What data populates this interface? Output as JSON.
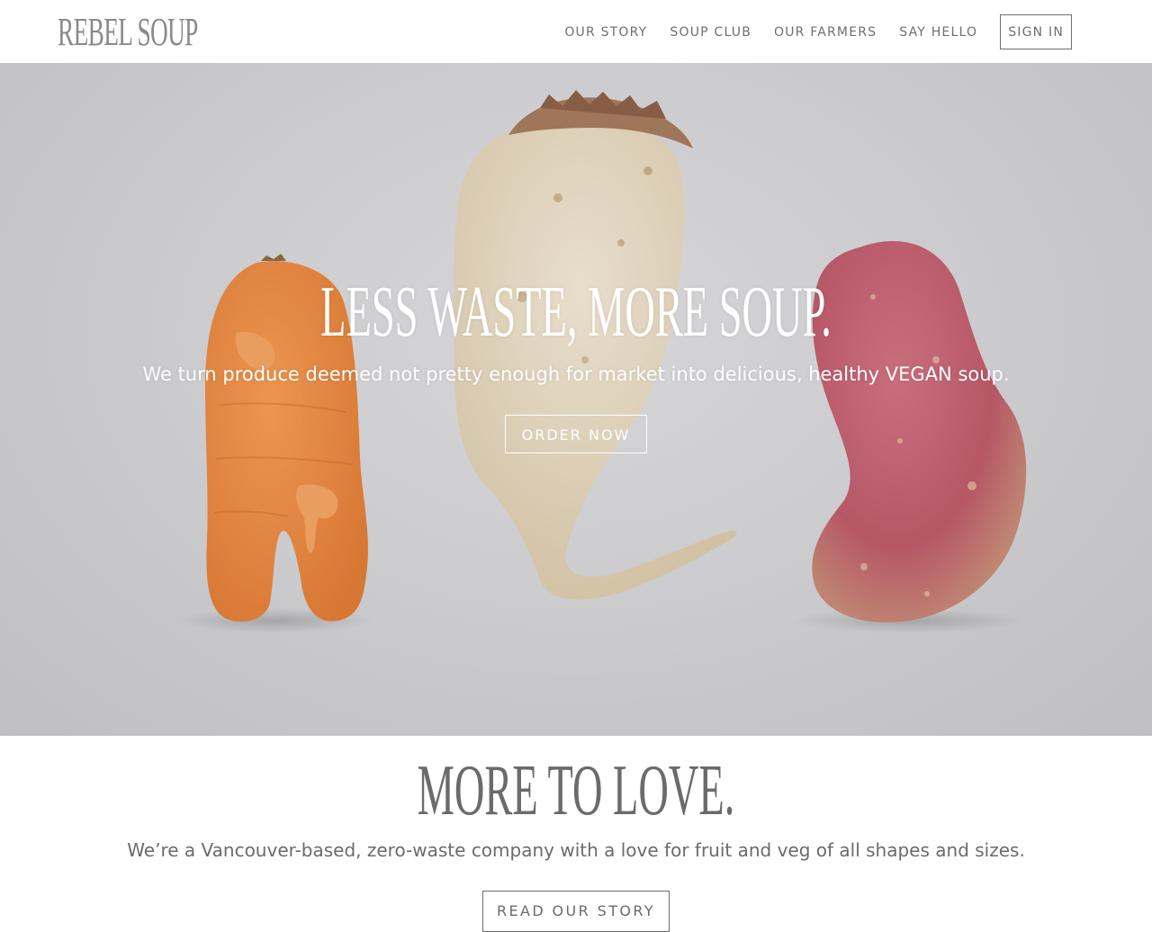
{
  "brand": {
    "logo_text": "REBEL SOUP"
  },
  "nav": {
    "items": [
      {
        "label": "OUR STORY"
      },
      {
        "label": "SOUP CLUB"
      },
      {
        "label": "OUR FARMERS"
      },
      {
        "label": "SAY HELLO"
      }
    ],
    "signin_label": "SIGN IN"
  },
  "hero": {
    "title": "LESS WASTE, MORE SOUP.",
    "subtitle": "We turn produce deemed not pretty enough for market into delicious, healthy VEGAN soup.",
    "cta_label": "ORDER NOW"
  },
  "about": {
    "title": "MORE TO LOVE.",
    "text": "We’re a Vancouver-based, zero-waste company with a love for fruit and veg of all shapes and sizes.",
    "cta_label": "READ OUR STORY"
  },
  "colors": {
    "text_gray": "#6b6b6b",
    "hero_background": "#d2d2d5",
    "carrot": "#f08a3e",
    "parsnip": "#e8dcc6",
    "sweet_potato": "#c25a6a"
  }
}
